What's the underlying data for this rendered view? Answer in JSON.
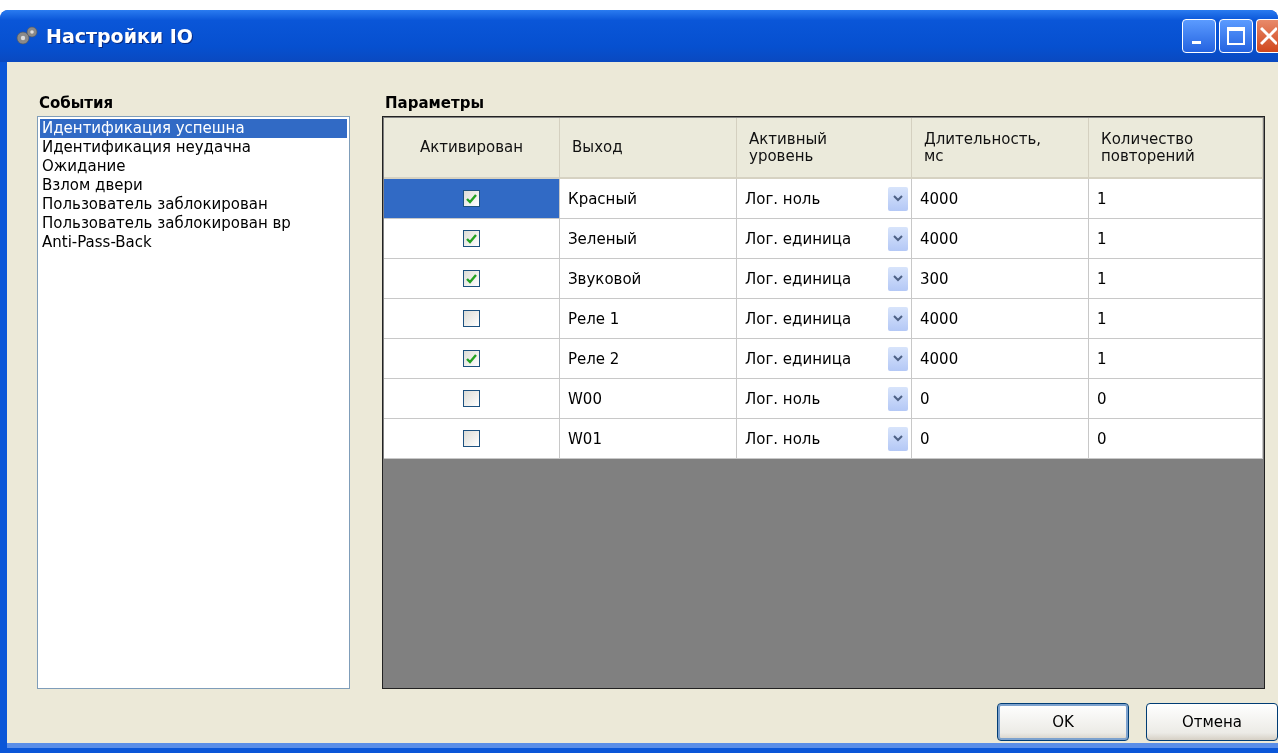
{
  "window": {
    "title": "Настройки IO"
  },
  "events": {
    "label": "События",
    "items": [
      {
        "text": "Идентификация успешна",
        "selected": true
      },
      {
        "text": "Идентификация неудачна",
        "selected": false
      },
      {
        "text": "Ожидание",
        "selected": false
      },
      {
        "text": "Взлом двери",
        "selected": false
      },
      {
        "text": "Пользователь заблокирован",
        "selected": false
      },
      {
        "text": "Пользователь заблокирован вр",
        "selected": false
      },
      {
        "text": "Anti-Pass-Back",
        "selected": false
      }
    ]
  },
  "parameters": {
    "label": "Параметры",
    "columns": [
      "Активирован",
      "Выход",
      "Активный уровень",
      "Длительность, мс",
      "Количество повторений"
    ],
    "rows": [
      {
        "selected": true,
        "checked": true,
        "output": "Красный",
        "active_level": "Лог. ноль",
        "duration": "4000",
        "repeats": "1"
      },
      {
        "selected": false,
        "checked": true,
        "output": "Зеленый",
        "active_level": "Лог. единица",
        "duration": "4000",
        "repeats": "1"
      },
      {
        "selected": false,
        "checked": true,
        "output": "Звуковой",
        "active_level": "Лог. единица",
        "duration": "300",
        "repeats": "1"
      },
      {
        "selected": false,
        "checked": false,
        "output": "Реле 1",
        "active_level": "Лог. единица",
        "duration": "4000",
        "repeats": "1"
      },
      {
        "selected": false,
        "checked": true,
        "output": "Реле 2",
        "active_level": "Лог. единица",
        "duration": "4000",
        "repeats": "1"
      },
      {
        "selected": false,
        "checked": false,
        "output": "W00",
        "active_level": "Лог. ноль",
        "duration": "0",
        "repeats": "0"
      },
      {
        "selected": false,
        "checked": false,
        "output": "W01",
        "active_level": "Лог. ноль",
        "duration": "0",
        "repeats": "0"
      }
    ]
  },
  "buttons": [
    {
      "label": "OK",
      "default": true
    },
    {
      "label": "Отмена",
      "default": false
    }
  ]
}
